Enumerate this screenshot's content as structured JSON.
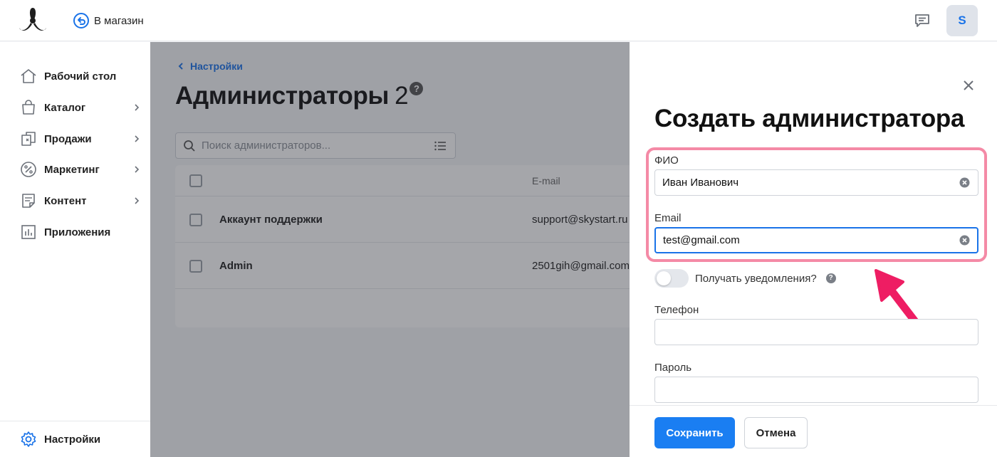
{
  "topbar": {
    "to_store_label": "В магазин",
    "avatar_letter": "S"
  },
  "sidebar": {
    "items": [
      {
        "label": "Рабочий стол",
        "icon": "home-icon"
      },
      {
        "label": "Каталог",
        "icon": "shopping-bag-icon"
      },
      {
        "label": "Продажи",
        "icon": "sales-icon"
      },
      {
        "label": "Маркетинг",
        "icon": "percent-icon"
      },
      {
        "label": "Контент",
        "icon": "document-icon"
      },
      {
        "label": "Приложения",
        "icon": "chart-icon"
      }
    ],
    "settings_label": "Настройки"
  },
  "main": {
    "breadcrumb": "Настройки",
    "title": "Администраторы",
    "count": "2",
    "help": "?",
    "search_placeholder": "Поиск администраторов...",
    "table": {
      "email_header": "E-mail",
      "rows": [
        {
          "name": "Аккаунт поддержки",
          "email": "support@skystart.ru"
        },
        {
          "name": "Admin",
          "email": "2501gih@gmail.com"
        }
      ]
    }
  },
  "drawer": {
    "title": "Создать администратора",
    "fio_label": "ФИО",
    "fio_value": "Иван Иванович",
    "email_label": "Email",
    "email_value": "test@gmail.com",
    "notify_label": "Получать уведомления?",
    "notify_help": "?",
    "notify_enabled": false,
    "phone_label": "Телефон",
    "phone_value": "",
    "password_label": "Пароль",
    "password_value": "",
    "save_label": "Сохранить",
    "cancel_label": "Отмена"
  },
  "colors": {
    "accent": "#1a7ef2",
    "highlight": "#f48aa6",
    "annotation_arrow": "#ee1d63"
  }
}
